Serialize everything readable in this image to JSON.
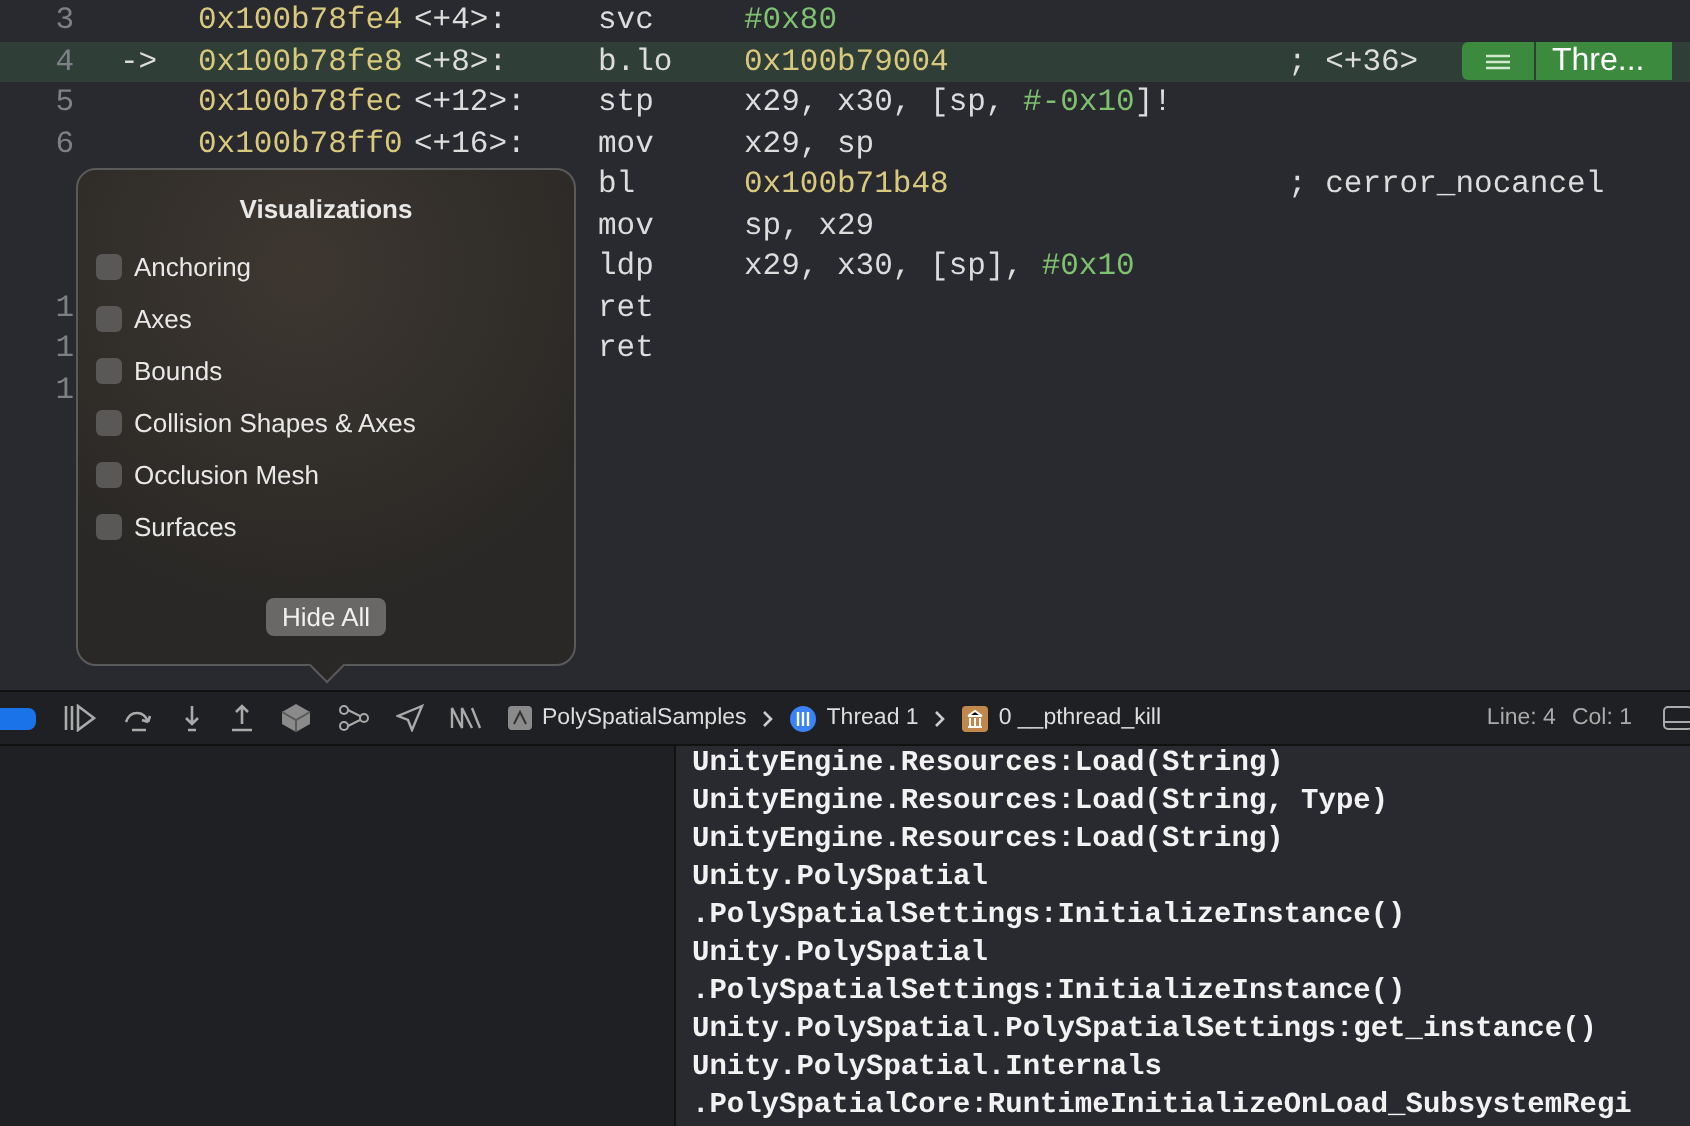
{
  "code_rows": [
    {
      "line": "3",
      "arrow": "",
      "selected": false,
      "address": "0x100b78fe4",
      "offset": "<+4>:",
      "mnemonic": "svc",
      "operands": [
        {
          "text": "#0x80",
          "kind": "imm"
        }
      ],
      "comment": ""
    },
    {
      "line": "4",
      "arrow": "->",
      "selected": true,
      "address": "0x100b78fe8",
      "offset": "<+8>:",
      "mnemonic": "b.lo",
      "operands": [
        {
          "text": "0x100b79004",
          "kind": "addr"
        }
      ],
      "comment": "; <+36>",
      "badge": "Thre..."
    },
    {
      "line": "5",
      "arrow": "",
      "selected": false,
      "address": "0x100b78fec",
      "offset": "<+12>:",
      "mnemonic": "stp",
      "operands": [
        {
          "text": "x29, x30, [sp, ",
          "kind": "reg"
        },
        {
          "text": "#-0x10",
          "kind": "imm"
        },
        {
          "text": "]!",
          "kind": "reg"
        }
      ],
      "comment": ""
    },
    {
      "line": "6",
      "arrow": "",
      "selected": false,
      "address": "0x100b78ff0",
      "offset": "<+16>:",
      "mnemonic": "mov",
      "operands": [
        {
          "text": "x29, sp",
          "kind": "reg"
        }
      ],
      "comment": ""
    },
    {
      "line": "",
      "arrow": "",
      "selected": false,
      "address": "",
      "offset": "",
      "mnemonic": "bl",
      "operands": [
        {
          "text": "0x100b71b48",
          "kind": "addr"
        }
      ],
      "comment": "; cerror_nocancel"
    },
    {
      "line": "",
      "arrow": "",
      "selected": false,
      "address": "",
      "offset": "",
      "mnemonic": "mov",
      "operands": [
        {
          "text": "sp, x29",
          "kind": "reg"
        }
      ],
      "comment": ""
    },
    {
      "line": "",
      "arrow": "",
      "selected": false,
      "address": "",
      "offset": "",
      "mnemonic": "ldp",
      "operands": [
        {
          "text": "x29, x30, [sp], ",
          "kind": "reg"
        },
        {
          "text": "#0x10",
          "kind": "imm"
        }
      ],
      "comment": ""
    },
    {
      "line": "1",
      "arrow": "",
      "selected": false,
      "address": "",
      "offset": "",
      "mnemonic": "ret",
      "operands": [],
      "comment": ""
    },
    {
      "line": "1",
      "arrow": "",
      "selected": false,
      "address": "",
      "offset": "",
      "mnemonic": "ret",
      "operands": [],
      "comment": ""
    },
    {
      "line": "1",
      "arrow": "",
      "selected": false,
      "address": "",
      "offset": "",
      "mnemonic": "",
      "operands": [],
      "comment": ""
    }
  ],
  "popover": {
    "title": "Visualizations",
    "options": [
      {
        "label": "Anchoring",
        "checked": false
      },
      {
        "label": "Axes",
        "checked": false
      },
      {
        "label": "Bounds",
        "checked": false
      },
      {
        "label": "Collision Shapes & Axes",
        "checked": false
      },
      {
        "label": "Occlusion Mesh",
        "checked": false
      },
      {
        "label": "Surfaces",
        "checked": false
      }
    ],
    "button": "Hide All"
  },
  "debug_bar": {
    "breakpoints_on": true,
    "breadcrumbs": [
      "PolySpatialSamples",
      "Thread 1",
      "0 __pthread_kill"
    ],
    "line": "Line: 4",
    "col": "Col: 1"
  },
  "console_lines": [
    "UnityEngine.Resources:Load(String)",
    "UnityEngine.Resources:Load(String, Type)",
    "UnityEngine.Resources:Load(String)",
    "Unity.PolySpatial",
    ".PolySpatialSettings:InitializeInstance()",
    "Unity.PolySpatial",
    ".PolySpatialSettings:InitializeInstance()",
    "Unity.PolySpatial.PolySpatialSettings:get_instance()",
    "Unity.PolySpatial.Internals",
    ".PolySpatialCore:RuntimeInitializeOnLoad_SubsystemRegi"
  ]
}
